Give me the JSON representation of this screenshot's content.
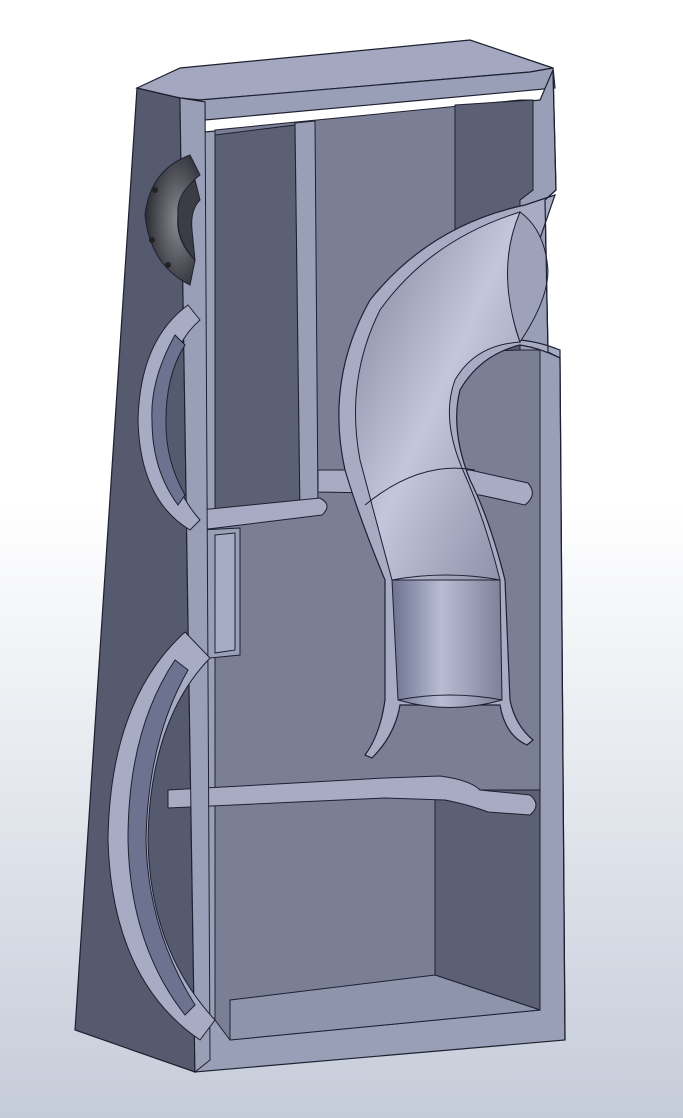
{
  "scene": {
    "kind": "cad-section-view",
    "object": "speaker-enclosure-cross-section",
    "colors": {
      "background_top": "#ffffff",
      "background_bottom": "#c9d0dd",
      "body_face": "#8a8fa8",
      "body_side": "#555a6e",
      "section_face": "#9a9fb8",
      "interior_wall": "#7a7f96",
      "interior_dark": "#5c6075",
      "edge_line": "#1e2030",
      "port_tube": "#a7acc4",
      "tweeter_dark": "#3c3d44"
    },
    "icons": [
      "tweeter-mount",
      "midrange-cutout",
      "woofer-cutout",
      "bass-reflex-port"
    ]
  }
}
